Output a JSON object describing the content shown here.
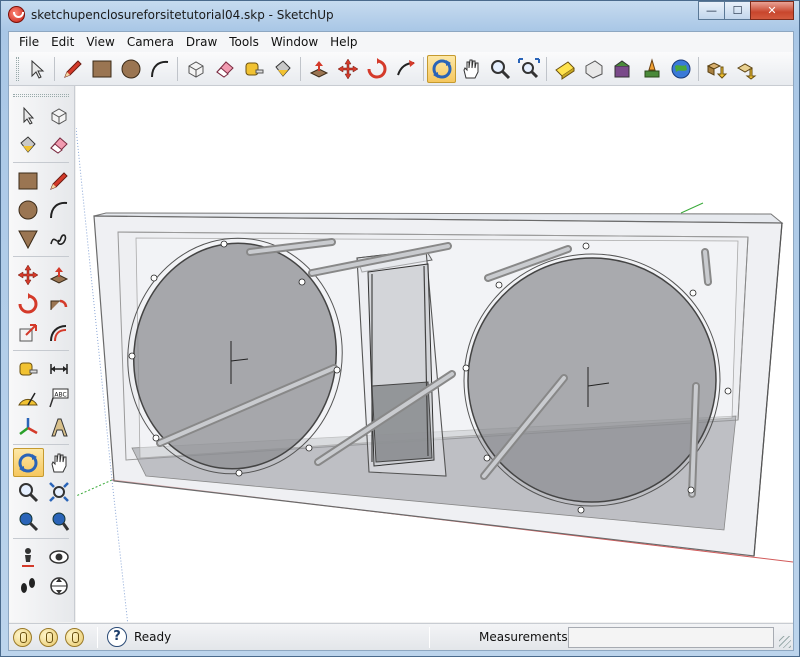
{
  "window": {
    "title": "sketchupenclosureforsitetutorial04.skp - SketchUp",
    "minimize_glyph": "—",
    "maximize_glyph": "☐",
    "close_glyph": "✕"
  },
  "menu": [
    "File",
    "Edit",
    "View",
    "Camera",
    "Draw",
    "Tools",
    "Window",
    "Help"
  ],
  "toolbar_top": [
    "select-icon",
    "pencil-icon",
    "rectangle-icon",
    "circle-icon",
    "arc-icon",
    "eraser-component-icon",
    "eraser-icon",
    "tape-measure-icon",
    "paint-bucket-icon",
    "push-pull-icon",
    "move-icon",
    "rotate-icon",
    "follow-me-icon",
    "orbit-icon",
    "pan-icon",
    "zoom-icon",
    "zoom-extents-icon",
    "get-models-icon",
    "share-model-icon",
    "warehouse-icon",
    "place-model-icon",
    "google-earth-icon",
    "components-icon",
    "get-current-view-icon"
  ],
  "statusbar": {
    "status": "Ready",
    "measurements_label": "Measurements",
    "measurements_value": "",
    "help_glyph": "?"
  },
  "colors": {
    "axis_red": "#cc3333",
    "axis_green": "#33aa33",
    "axis_blue": "#3366cc",
    "active_tool": "#f6c75e"
  }
}
